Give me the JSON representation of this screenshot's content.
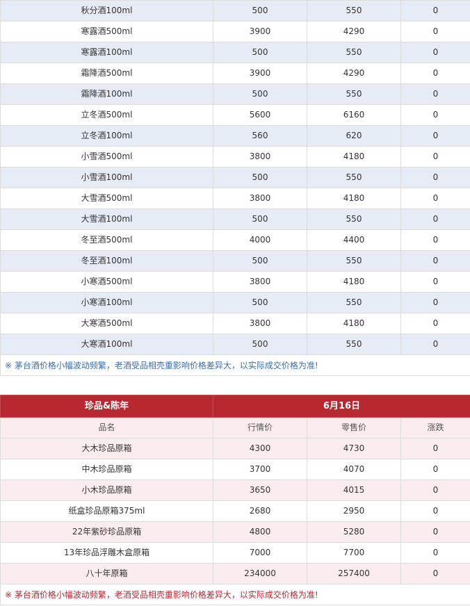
{
  "section1": {
    "rows": [
      [
        "秋分酒100ml",
        "500",
        "550",
        "0"
      ],
      [
        "寒露酒500ml",
        "3900",
        "4290",
        "0"
      ],
      [
        "寒露酒100ml",
        "500",
        "550",
        "0"
      ],
      [
        "霜降酒500ml",
        "3900",
        "4290",
        "0"
      ],
      [
        "霜降酒100ml",
        "500",
        "550",
        "0"
      ],
      [
        "立冬酒500ml",
        "5600",
        "6160",
        "0"
      ],
      [
        "立冬酒100ml",
        "560",
        "620",
        "0"
      ],
      [
        "小雪酒500ml",
        "3800",
        "4180",
        "0"
      ],
      [
        "小雪酒100ml",
        "500",
        "550",
        "0"
      ],
      [
        "大雪酒500ml",
        "3800",
        "4180",
        "0"
      ],
      [
        "大雪酒100ml",
        "500",
        "550",
        "0"
      ],
      [
        "冬至酒500ml",
        "4000",
        "4400",
        "0"
      ],
      [
        "冬至酒100ml",
        "500",
        "550",
        "0"
      ],
      [
        "小寒酒500ml",
        "3800",
        "4180",
        "0"
      ],
      [
        "小寒酒100ml",
        "500",
        "550",
        "0"
      ],
      [
        "大寒酒500ml",
        "3800",
        "4180",
        "0"
      ],
      [
        "大寒酒100ml",
        "500",
        "550",
        "0"
      ]
    ],
    "note": "※ 茅台酒价格小幅波动频繁，老酒受品相壳重影响价格差异大，以实际成交价格为准!"
  },
  "section2": {
    "title": "珍品&陈年",
    "date": "6月16日",
    "columns": [
      "品名",
      "行情价",
      "零售价",
      "涨跌"
    ],
    "rows": [
      [
        "大木珍品原箱",
        "4300",
        "4730",
        "0"
      ],
      [
        "中木珍品原箱",
        "3700",
        "4070",
        "0"
      ],
      [
        "小木珍品原箱",
        "3650",
        "4015",
        "0"
      ],
      [
        "纸盒珍品原箱375ml",
        "2680",
        "2950",
        "0"
      ],
      [
        "22年紫砂珍品原箱",
        "4800",
        "5280",
        "0"
      ],
      [
        "13年珍品浮雕木盒原箱",
        "7000",
        "7700",
        "0"
      ],
      [
        "八十年原箱",
        "234000",
        "257400",
        "0"
      ]
    ],
    "note": "※ 茅台酒价格小幅波动频繁，老酒受品相壳重影响价格差异大，以实际成交价格为准!"
  }
}
